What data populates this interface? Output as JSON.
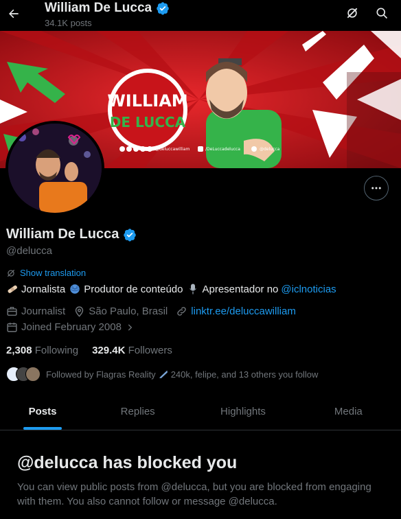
{
  "header": {
    "title": "William De Lucca",
    "posts_count": "34.1K posts",
    "back_icon": "arrow-left-icon",
    "grok_icon": "grok-icon",
    "search_icon": "search-icon"
  },
  "banner": {
    "logo_text_top": "WILLIAM",
    "logo_text_bottom": "DE LUCCA",
    "social_1": "@deluccawilliam",
    "social_2": "/DeLuccadelucca",
    "social_3": "@delucca"
  },
  "profile": {
    "name": "William De Lucca",
    "handle": "@delucca",
    "verified": true,
    "show_translation": "Show translation",
    "bio_parts": {
      "p1": "Jornalista",
      "p2": "Produtor de conteúdo",
      "p3": "Apresentador no",
      "mention": "@iclnoticias"
    },
    "profession": "Journalist",
    "location": "São Paulo, Brasil",
    "website": "linktr.ee/deluccawilliam",
    "joined": "Joined February 2008",
    "following_count": "2,308",
    "following_label": "Following",
    "followers_count": "329.4K",
    "followers_label": "Followers",
    "followed_by": "Followed by Flagras Reality",
    "followed_by_rest": "240k, felipe, and 13 others you follow"
  },
  "tabs": [
    {
      "label": "Posts",
      "active": true
    },
    {
      "label": "Replies",
      "active": false
    },
    {
      "label": "Highlights",
      "active": false
    },
    {
      "label": "Media",
      "active": false
    }
  ],
  "blocked": {
    "title": "@delucca has blocked you",
    "message": "You can view public posts from @delucca, but you are blocked from engaging with them. You also cannot follow or message @delucca."
  },
  "colors": {
    "accent": "#1d9bf0",
    "muted": "#71767b",
    "banner_red": "#c8141a",
    "banner_green": "#2fa84f"
  }
}
